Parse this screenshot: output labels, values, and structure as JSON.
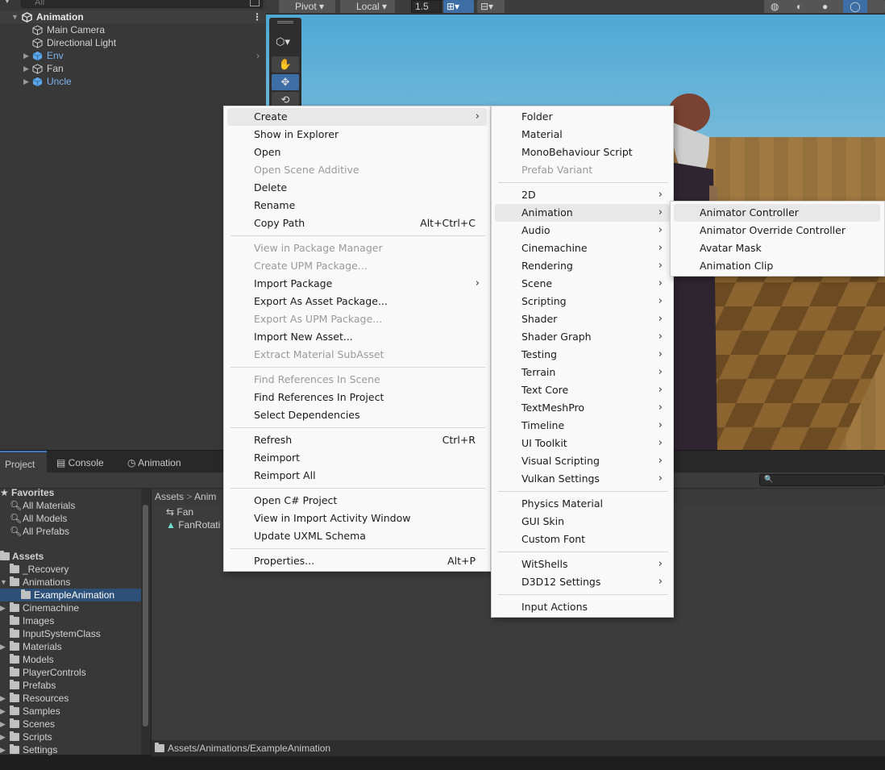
{
  "hierarchy": {
    "search_placeholder": "All",
    "scene": "Animation",
    "items": [
      "Main Camera",
      "Directional Light",
      "Env",
      "Fan",
      "Uncle"
    ]
  },
  "toolbar": {
    "pivot": "Pivot",
    "local": "Local",
    "snap_value": "1.5"
  },
  "tabs": [
    "Project",
    "Console",
    "Animation"
  ],
  "project": {
    "favorites_label": "Favorites",
    "favorites": [
      "All Materials",
      "All Models",
      "All Prefabs"
    ],
    "assets_label": "Assets",
    "folders": [
      "_Recovery",
      "Animations",
      "ExampleAnimation",
      "Cinemachine",
      "Images",
      "InputSystemClass",
      "Materials",
      "Models",
      "PlayerControls",
      "Prefabs",
      "Resources",
      "Samples",
      "Scenes",
      "Scripts",
      "Settings"
    ],
    "breadcrumb": [
      "Assets",
      ">",
      "Anim"
    ],
    "files": [
      "Fan",
      "FanRotati"
    ],
    "path": "Assets/Animations/ExampleAnimation"
  },
  "context_menu": {
    "items": [
      {
        "label": "Create",
        "submenu": true,
        "highlighted": true
      },
      {
        "label": "Show in Explorer"
      },
      {
        "label": "Open"
      },
      {
        "label": "Open Scene Additive",
        "disabled": true
      },
      {
        "label": "Delete"
      },
      {
        "label": "Rename"
      },
      {
        "label": "Copy Path",
        "shortcut": "Alt+Ctrl+C"
      },
      {
        "label": "View in Package Manager",
        "disabled": true
      },
      {
        "label": "Create UPM Package...",
        "disabled": true
      },
      {
        "label": "Import Package",
        "submenu": true
      },
      {
        "label": "Export As Asset Package..."
      },
      {
        "label": "Export As UPM Package...",
        "disabled": true
      },
      {
        "label": "Import New Asset..."
      },
      {
        "label": "Extract Material SubAsset",
        "disabled": true
      },
      {
        "label": "Find References In Scene",
        "disabled": true
      },
      {
        "label": "Find References In Project"
      },
      {
        "label": "Select Dependencies"
      },
      {
        "label": "Refresh",
        "shortcut": "Ctrl+R"
      },
      {
        "label": "Reimport"
      },
      {
        "label": "Reimport All"
      },
      {
        "label": "Open C# Project"
      },
      {
        "label": "View in Import Activity Window"
      },
      {
        "label": "Update UXML Schema"
      },
      {
        "label": "Properties...",
        "shortcut": "Alt+P"
      }
    ]
  },
  "create_menu": {
    "items": [
      {
        "label": "Folder"
      },
      {
        "label": "Material"
      },
      {
        "label": "MonoBehaviour Script"
      },
      {
        "label": "Prefab Variant",
        "disabled": true
      },
      {
        "label": "2D",
        "submenu": true
      },
      {
        "label": "Animation",
        "submenu": true,
        "highlighted": true
      },
      {
        "label": "Audio",
        "submenu": true
      },
      {
        "label": "Cinemachine",
        "submenu": true
      },
      {
        "label": "Rendering",
        "submenu": true
      },
      {
        "label": "Scene",
        "submenu": true
      },
      {
        "label": "Scripting",
        "submenu": true
      },
      {
        "label": "Shader",
        "submenu": true
      },
      {
        "label": "Shader Graph",
        "submenu": true
      },
      {
        "label": "Testing",
        "submenu": true
      },
      {
        "label": "Terrain",
        "submenu": true
      },
      {
        "label": "Text Core",
        "submenu": true
      },
      {
        "label": "TextMeshPro",
        "submenu": true
      },
      {
        "label": "Timeline",
        "submenu": true
      },
      {
        "label": "UI Toolkit",
        "submenu": true
      },
      {
        "label": "Visual Scripting",
        "submenu": true
      },
      {
        "label": "Vulkan Settings",
        "submenu": true
      },
      {
        "label": "Physics Material"
      },
      {
        "label": "GUI Skin"
      },
      {
        "label": "Custom Font"
      },
      {
        "label": "WitShells",
        "submenu": true
      },
      {
        "label": "D3D12 Settings",
        "submenu": true
      },
      {
        "label": "Input Actions"
      }
    ]
  },
  "animation_menu": {
    "items": [
      {
        "label": "Animator Controller",
        "highlighted": true
      },
      {
        "label": "Animator Override Controller"
      },
      {
        "label": "Avatar Mask"
      },
      {
        "label": "Animation Clip"
      }
    ]
  }
}
